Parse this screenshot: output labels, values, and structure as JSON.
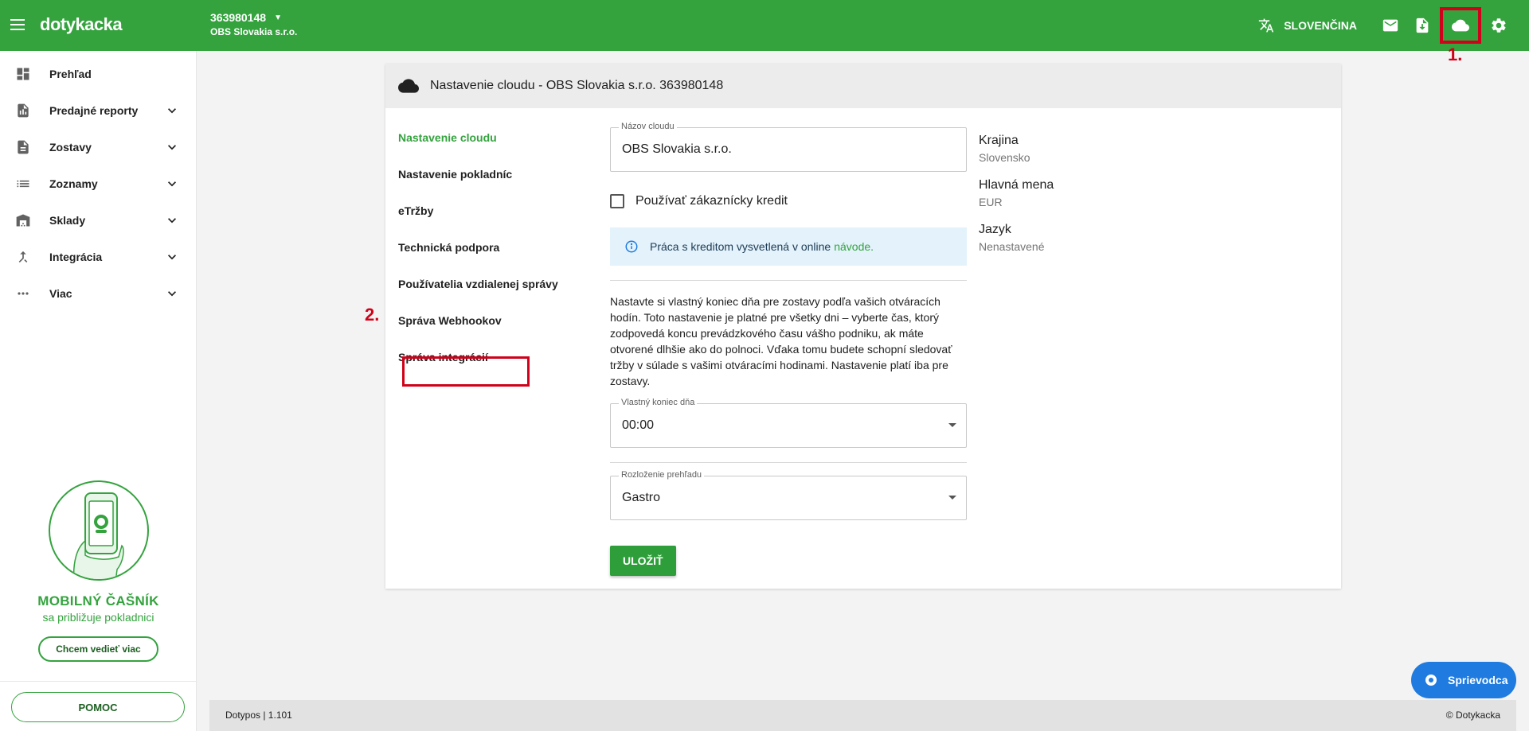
{
  "app": {
    "logo": "dotykacka",
    "company_id": "363980148",
    "company_name": "OBS Slovakia s.r.o.",
    "language": "SLOVENČINA",
    "colors": {
      "primary": "#34a33e",
      "annotation": "#d0021b",
      "info_bg": "#e3f2fb",
      "guide": "#1f7be0"
    }
  },
  "annotations": {
    "step1": "1.",
    "step2": "2."
  },
  "sidebar": {
    "items": [
      {
        "label": "Prehľad",
        "icon": "dashboard-icon"
      },
      {
        "label": "Predajné reporty",
        "icon": "report-icon"
      },
      {
        "label": "Zostavy",
        "icon": "document-icon"
      },
      {
        "label": "Zoznamy",
        "icon": "list-icon"
      },
      {
        "label": "Sklady",
        "icon": "warehouse-icon"
      },
      {
        "label": "Integrácia",
        "icon": "merge-icon"
      },
      {
        "label": "Viac",
        "icon": "more-icon"
      }
    ],
    "promo": {
      "title": "MOBILNÝ ČAŠNÍK",
      "subtitle": "sa približuje pokladnici",
      "button": "Chcem vedieť viac"
    },
    "help_button": "POMOC"
  },
  "card": {
    "title": "Nastavenie cloudu - OBS Slovakia s.r.o. 363980148",
    "subnav": [
      "Nastavenie cloudu",
      "Nastavenie pokladníc",
      "eTržby",
      "Technická podpora",
      "Používatelia vzdialenej správy",
      "Správa Webhookov",
      "Správa integrácií"
    ],
    "form": {
      "cloud_name_label": "Názov cloudu",
      "cloud_name_value": "OBS Slovakia s.r.o.",
      "credit_checkbox": "Používať zákaznícky kredit",
      "info_text": "Práca s kreditom vysvetlená v online",
      "info_link": "návode.",
      "description": "Nastavte si vlastný koniec dňa pre zostavy podľa vašich otváracích hodín. Toto nastavenie je platné pre všetky dni – vyberte čas, ktorý zodpovedá koncu prevádzkového času vášho podniku, ak máte otvorené dlhšie ako do polnoci. Vďaka tomu budete schopní sledovať tržby v súlade s vašimi otváracími hodinami. Nastavenie platí iba pre zostavy.",
      "end_of_day_label": "Vlastný koniec dňa",
      "end_of_day_value": "00:00",
      "layout_label": "Rozloženie prehľadu",
      "layout_value": "Gastro",
      "save_button": "ULOŽIŤ"
    },
    "meta": [
      {
        "key": "Krajina",
        "value": "Slovensko"
      },
      {
        "key": "Hlavná mena",
        "value": "EUR"
      },
      {
        "key": "Jazyk",
        "value": "Nenastavené"
      }
    ]
  },
  "footer": {
    "left": "Dotypos  | 1.101",
    "right": "© Dotykacka"
  },
  "guide_button": "Sprievodca"
}
